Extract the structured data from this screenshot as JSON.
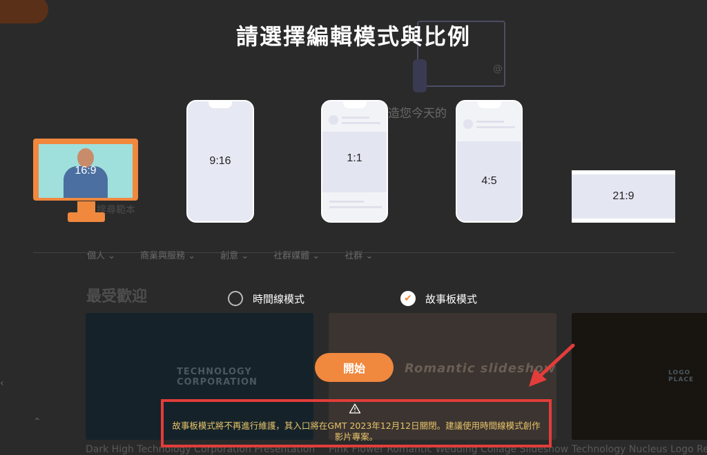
{
  "dialog": {
    "title": "請選擇編輯模式與比例"
  },
  "ratios": [
    {
      "label": "16:9"
    },
    {
      "label": "9:16"
    },
    {
      "label": "1:1"
    },
    {
      "label": "4:5"
    },
    {
      "label": "21:9"
    }
  ],
  "modes": {
    "timeline": "時間線模式",
    "storyboard": "故事板模式",
    "selected": "storyboard"
  },
  "start_button": "開始",
  "warning": {
    "text": "故事板模式將不再進行維護，其入口將在GMT 2023年12月12日關閉。建議使用時間線模式創作影片專案。"
  },
  "background": {
    "subhead": "造您今天的",
    "search_placeholder": "搜尋範本",
    "categories": [
      "個人",
      "商業與服務",
      "創意",
      "社群媒體",
      "社群"
    ],
    "section_title": "最受歡迎",
    "cards": [
      {
        "title": "Dark High Technology Corporation Presentation",
        "logo": "TECHNOLOGY CORPORATION"
      },
      {
        "title": "Pink Flower Romantic Wedding Collage Slideshow",
        "logo": "Romantic slideshow"
      },
      {
        "title": "Technology Nucleus Logo Reveal",
        "logo": "LOGO PLACE"
      }
    ]
  },
  "colors": {
    "accent": "#f0883e",
    "warning_border": "#e33d3a",
    "warning_text": "#e8c56a"
  }
}
